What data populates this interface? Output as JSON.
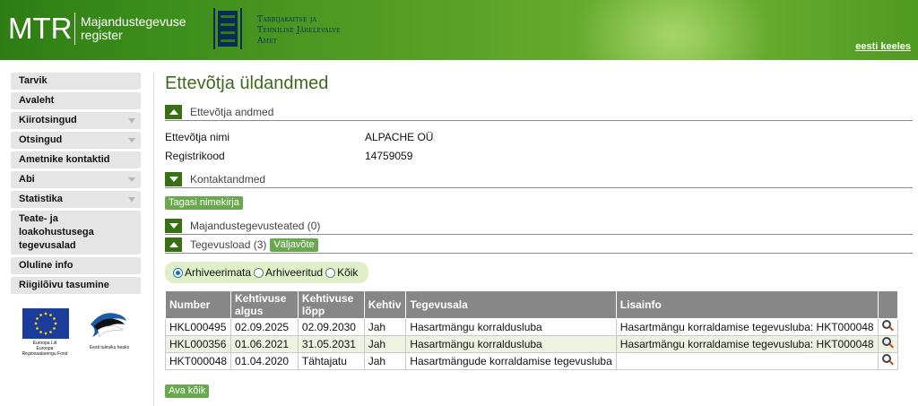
{
  "header": {
    "logo_mtr": "MTR",
    "logo_sub_line1": "Majandustegevuse",
    "logo_sub_line2": "register",
    "agency_line1": "Tarbijakaitse ja",
    "agency_line2": "Tehnilise Järelevalve",
    "agency_line3": "Amet",
    "language_link": "eesti keeles"
  },
  "sidebar": {
    "items": [
      {
        "label": "Tarvik",
        "has_arrow": false
      },
      {
        "label": "Avaleht",
        "has_arrow": false
      },
      {
        "label": "Kiirotsingud",
        "has_arrow": true
      },
      {
        "label": "Otsingud",
        "has_arrow": true
      },
      {
        "label": "Ametnike kontaktid",
        "has_arrow": false
      },
      {
        "label": "Abi",
        "has_arrow": true
      },
      {
        "label": "Statistika",
        "has_arrow": true
      },
      {
        "label": "Teate- ja loakohustusega tegevusalad",
        "has_arrow": false
      },
      {
        "label": "Oluline info",
        "has_arrow": false
      },
      {
        "label": "Riigilõivu tasumine",
        "has_arrow": false
      }
    ],
    "eu_caption_1": "Euroopa Liit",
    "eu_caption_2": "Euroopa",
    "eu_caption_3": "Regionaalarengu Fond",
    "ee_caption": "Eesti tuleviku heaks"
  },
  "main": {
    "page_title": "Ettevõtja üldandmed",
    "company_section": {
      "label": "Ettevõtja andmed",
      "name_label": "Ettevõtja nimi",
      "name_value": "ALPACHE OÜ",
      "regcode_label": "Registrikood",
      "regcode_value": "14759059"
    },
    "contact_section": {
      "label": "Kontaktandmed"
    },
    "back_button": "Tagasi nimekirja",
    "notices_section": {
      "label": "Majandustegevusteated (0)"
    },
    "licenses_section": {
      "label": "Tegevusload (3)",
      "extract_button": "Väljavõte"
    },
    "filter": {
      "options": [
        "Arhiveerimata",
        "Arhiveeritud",
        "Kõik"
      ],
      "selected": "Arhiveerimata"
    },
    "table": {
      "columns": [
        "Number",
        "Kehtivuse algus",
        "Kehtivuse lõpp",
        "Kehtiv",
        "Tegevusala",
        "Lisainfo",
        ""
      ],
      "rows": [
        [
          "HKL000495",
          "02.09.2025",
          "02.09.2030",
          "Jah",
          "Hasartmängu korraldusluba",
          "Hasartmängu korraldamise tegevusluba: HKT000048"
        ],
        [
          "HKL000356",
          "01.06.2021",
          "31.05.2031",
          "Jah",
          "Hasartmängu korraldusluba",
          "Hasartmängu korraldamise tegevusluba: HKT000048"
        ],
        [
          "HKT000048",
          "01.04.2020",
          "Tähtajatu",
          "Jah",
          "Hasartmängude korraldamise tegevusluba",
          ""
        ]
      ]
    },
    "open_all_button": "Ava kõik"
  },
  "colors": {
    "accent_green": "#3a7014",
    "title_green": "#3f6a1e",
    "button_green": "#6aa84f",
    "table_header": "#878787",
    "row_alt": "#ecf3e2"
  }
}
